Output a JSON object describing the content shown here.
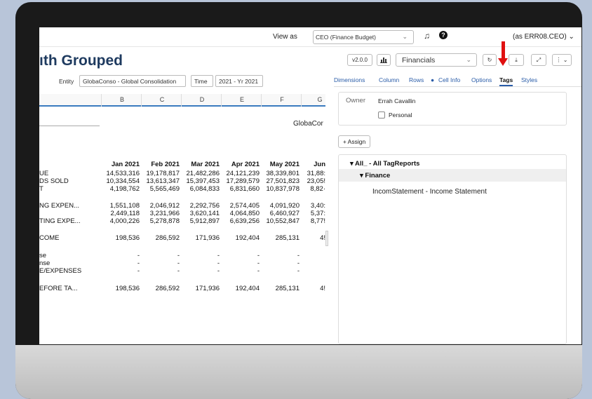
{
  "topbar": {
    "view_as_label": "View as",
    "role_value": "CEO (Finance Budget)",
    "user_label": "(as ERR08.CEO) ⌄"
  },
  "report": {
    "title": "ıth Grouped",
    "pov": [
      {
        "label": "Entity",
        "value": "GlobaConso - Global Consolidation"
      },
      {
        "label": "Time",
        "value": "2021 - Yr 2021"
      }
    ],
    "columns": [
      "B",
      "C",
      "D",
      "E",
      "F",
      "G"
    ],
    "entity_heading": "GlobaCor",
    "months": [
      "Jan 2021",
      "Feb 2021",
      "Mar 2021",
      "Apr 2021",
      "May 2021",
      "Jun"
    ],
    "rows": [
      {
        "label": "UE",
        "values": [
          "14,533,316",
          "19,178,817",
          "21,482,286",
          "24,121,239",
          "38,339,801",
          "31,88:"
        ]
      },
      {
        "label": "DS SOLD",
        "values": [
          "10,334,554",
          "13,613,347",
          "15,397,453",
          "17,289,579",
          "27,501,823",
          "23,05!"
        ]
      },
      {
        "label": "T",
        "values": [
          "4,198,762",
          "5,565,469",
          "6,084,833",
          "6,831,660",
          "10,837,978",
          "8,82·"
        ]
      },
      {
        "label": "NG EXPEN...",
        "values": [
          "1,551,108",
          "2,046,912",
          "2,292,756",
          "2,574,405",
          "4,091,920",
          "3,40:"
        ]
      },
      {
        "label": "",
        "values": [
          "2,449,118",
          "3,231,966",
          "3,620,141",
          "4,064,850",
          "6,460,927",
          "5,37:"
        ]
      },
      {
        "label": "TING EXPE...",
        "values": [
          "4,000,226",
          "5,278,878",
          "5,912,897",
          "6,639,256",
          "10,552,847",
          "8,77!"
        ]
      },
      {
        "label": "COME",
        "values": [
          "198,536",
          "286,592",
          "171,936",
          "192,404",
          "285,131",
          "4!"
        ]
      },
      {
        "label": "se",
        "values": [
          "-",
          "-",
          "-",
          "-",
          "-",
          ""
        ]
      },
      {
        "label": "nse",
        "values": [
          "-",
          "-",
          "-",
          "-",
          "-",
          ""
        ]
      },
      {
        "label": "E/EXPENSES",
        "values": [
          "-",
          "-",
          "-",
          "-",
          "-",
          ""
        ]
      },
      {
        "label": "EFORE TA...",
        "values": [
          "198,536",
          "286,592",
          "171,936",
          "192,404",
          "285,131",
          "4!"
        ]
      }
    ]
  },
  "toolbar": {
    "version": "v2.0.0",
    "chart_icon": "bar-chart-icon",
    "layout_value": "Financials",
    "refresh_icon": "refresh-icon",
    "download_icon": "download-icon",
    "expand_icon": "expand-icon",
    "more_icon": "more-vertical-icon"
  },
  "panel": {
    "tabs": [
      "Dimensions",
      "Column",
      "Rows",
      "Cell Info",
      "Options",
      "Tags",
      "Styles"
    ],
    "active_tab": "Tags",
    "owner_label": "Owner",
    "owner_value": "Errah Cavallin",
    "personal_label": "Personal",
    "assign_label": "+ Assign",
    "tree": {
      "root": "▾  All_ - All TagReports",
      "group": "▾  Finance",
      "item": "IncomStatement - Income Statement"
    }
  },
  "colors": {
    "title": "#1e3a5f",
    "accent": "#2a5ca8",
    "annotation_arrow": "#e01010"
  }
}
